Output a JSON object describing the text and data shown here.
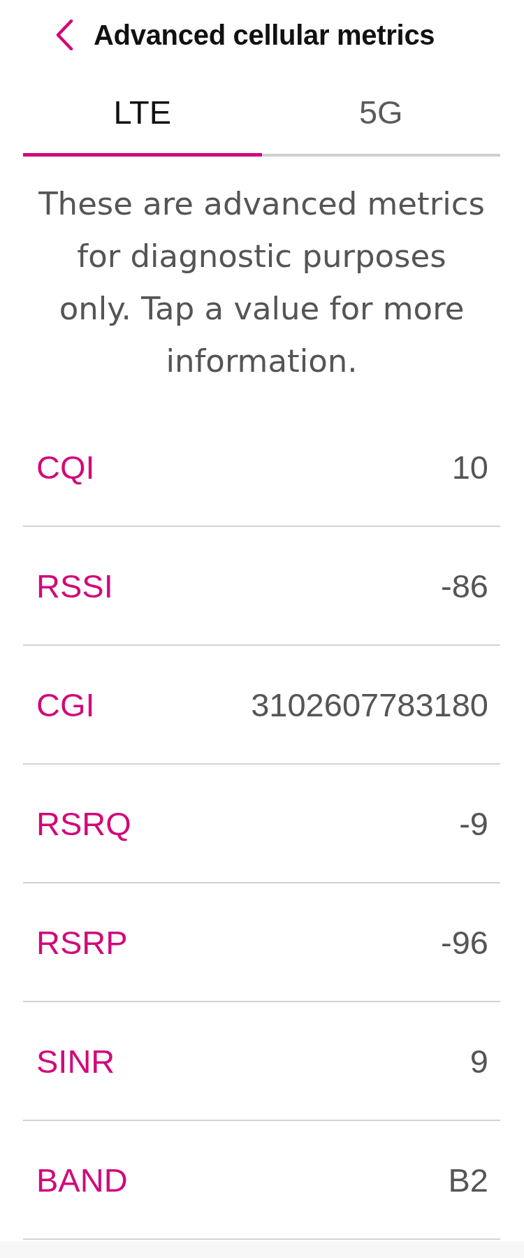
{
  "header": {
    "title": "Advanced cellular metrics"
  },
  "tabs": [
    {
      "label": "LTE",
      "selected": true
    },
    {
      "label": "5G",
      "selected": false
    }
  ],
  "description": "These are advanced metrics for diagnostic purposes only. Tap a value for more information.",
  "metrics": [
    {
      "name": "CQI",
      "value": "10"
    },
    {
      "name": "RSSI",
      "value": "-86"
    },
    {
      "name": "CGI",
      "value": "3102607783180"
    },
    {
      "name": "RSRQ",
      "value": "-9"
    },
    {
      "name": "RSRP",
      "value": "-96"
    },
    {
      "name": "SINR",
      "value": "9"
    },
    {
      "name": "BAND",
      "value": "B2"
    }
  ]
}
